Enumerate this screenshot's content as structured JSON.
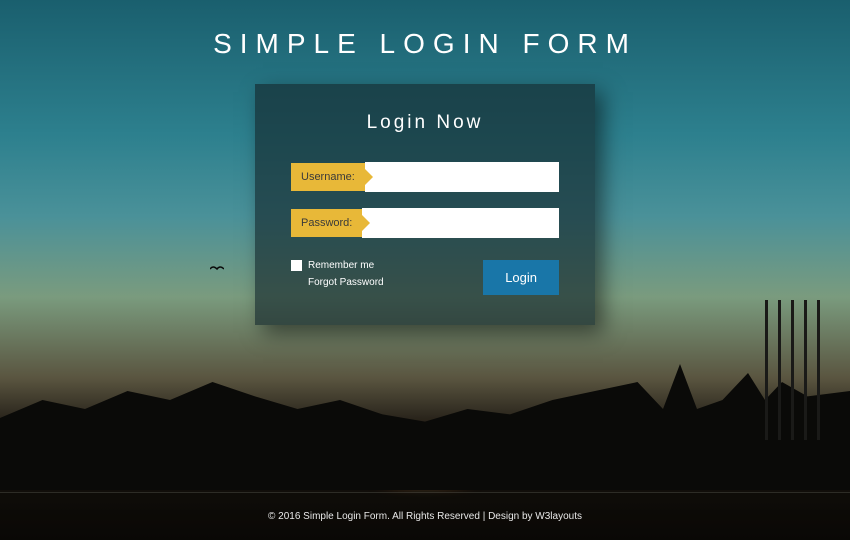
{
  "header": {
    "title": "SIMPLE LOGIN FORM"
  },
  "card": {
    "title": "Login Now",
    "username_label": "Username:",
    "username_value": "",
    "password_label": "Password:",
    "password_value": "",
    "remember_label": "Remember me",
    "forgot_label": "Forgot Password",
    "login_button": "Login"
  },
  "footer": {
    "text": "© 2016 Simple Login Form. All Rights Reserved | Design by W3layouts"
  },
  "colors": {
    "accent_yellow": "#e8b838",
    "button_blue": "#1976a8"
  }
}
